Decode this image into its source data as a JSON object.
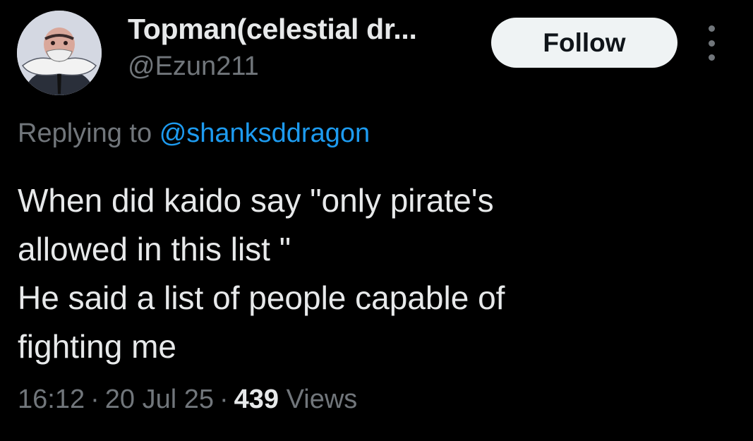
{
  "author": {
    "display_name": "Topman(celestial dr...",
    "handle": "@Ezun211",
    "avatar_icon": "anime-character-avatar"
  },
  "actions": {
    "follow_label": "Follow",
    "more_icon": "more-vertical-icon"
  },
  "reply": {
    "prefix": "Replying to",
    "mention": "@shanksddragon"
  },
  "body": {
    "lines": [
      "When did kaido say \"only pirate's",
      "allowed in this list \"",
      "He said a list of people capable of",
      "fighting me"
    ]
  },
  "meta": {
    "time": "16:12",
    "separator": "·",
    "date": "20 Jul 25",
    "views_count": "439",
    "views_label": "Views"
  },
  "colors": {
    "background": "#000000",
    "text_primary": "#e7e9ea",
    "text_secondary": "#71767b",
    "link": "#1d9bf0",
    "button_bg": "#eff3f4"
  }
}
